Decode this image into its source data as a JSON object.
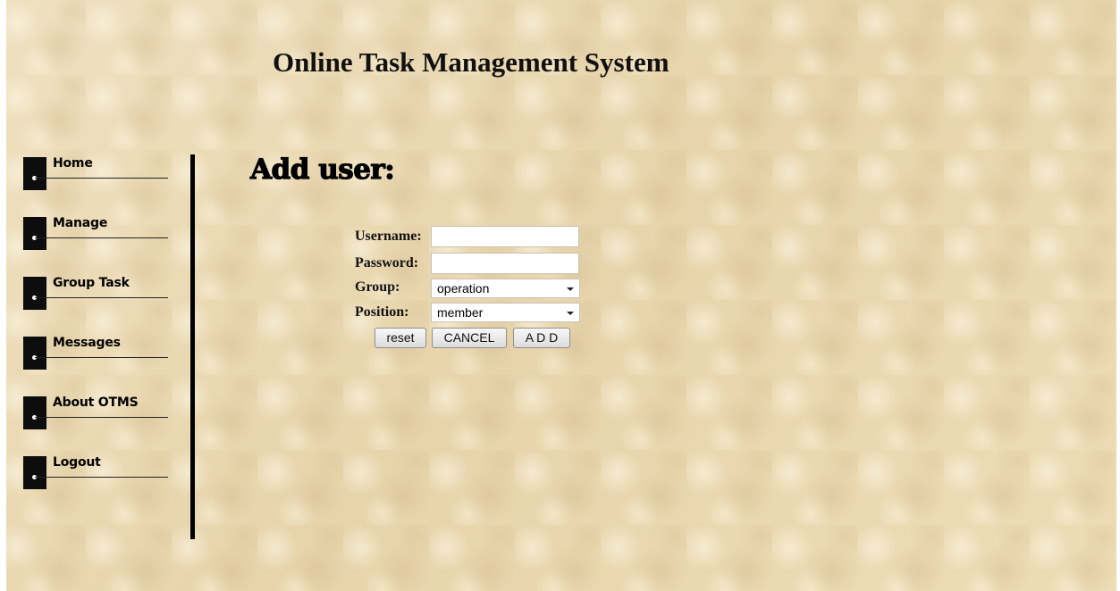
{
  "header": {
    "title": "Online Task Management System"
  },
  "sidebar": {
    "items": [
      {
        "label": "Home"
      },
      {
        "label": "Manage"
      },
      {
        "label": "Group Task"
      },
      {
        "label": "Messages"
      },
      {
        "label": "About OTMS"
      },
      {
        "label": "Logout"
      }
    ]
  },
  "main": {
    "heading": "Add user:"
  },
  "form": {
    "username_label": "Username:",
    "username_value": "",
    "password_label": "Password:",
    "password_value": "",
    "group_label": "Group:",
    "group_selected": "operation",
    "position_label": "Position:",
    "position_selected": "member",
    "reset_label": "reset",
    "cancel_label": "CANCEL",
    "add_label": "A D D"
  },
  "colors": {
    "background": "#ecdcb8",
    "text": "#000000",
    "nav_block": "#0d0d0d"
  }
}
